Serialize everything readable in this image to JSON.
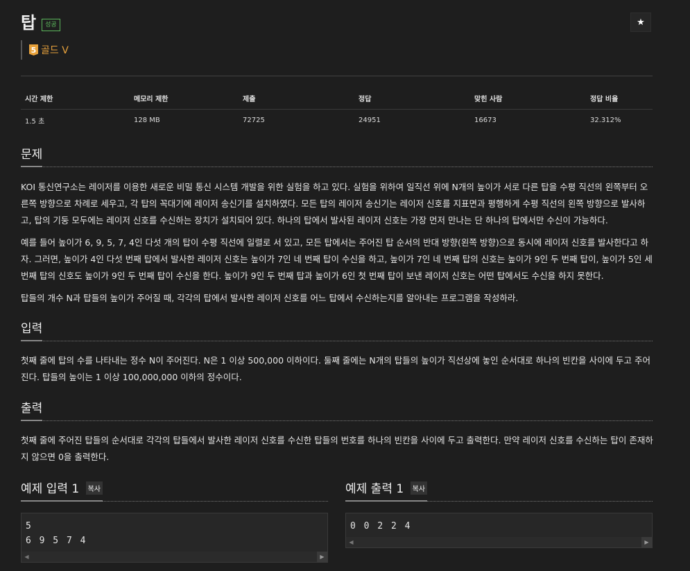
{
  "problem": {
    "title": "탑",
    "status_badge": "성공",
    "tier_number": "5",
    "tier_label": "골드 V",
    "star_icon": "★"
  },
  "stats": {
    "headers": [
      "시간 제한",
      "메모리 제한",
      "제출",
      "정답",
      "맞힌 사람",
      "정답 비율"
    ],
    "values": [
      "1.5 초",
      "128 MB",
      "72725",
      "24951",
      "16673",
      "32.312%"
    ]
  },
  "sections": {
    "description": {
      "heading": "문제",
      "paragraphs": [
        "KOI 통신연구소는 레이저를 이용한 새로운 비밀 통신 시스템 개발을 위한 실험을 하고 있다. 실험을 위하여 일직선 위에 N개의 높이가 서로 다른 탑을 수평 직선의 왼쪽부터 오른쪽 방향으로 차례로 세우고, 각 탑의 꼭대기에 레이저 송신기를 설치하였다. 모든 탑의 레이저 송신기는 레이저 신호를 지표면과 평행하게 수평 직선의 왼쪽 방향으로 발사하고, 탑의 기둥 모두에는 레이저 신호를 수신하는 장치가 설치되어 있다. 하나의 탑에서 발사된 레이저 신호는 가장 먼저 만나는 단 하나의 탑에서만 수신이 가능하다.",
        "예를 들어 높이가 6, 9, 5, 7, 4인 다섯 개의 탑이 수평 직선에 일렬로 서 있고, 모든 탑에서는 주어진 탑 순서의 반대 방향(왼쪽 방향)으로 동시에 레이저 신호를 발사한다고 하자. 그러면, 높이가 4인 다섯 번째 탑에서 발사한 레이저 신호는 높이가 7인 네 번째 탑이 수신을 하고, 높이가 7인 네 번째 탑의 신호는 높이가 9인 두 번째 탑이, 높이가 5인 세 번째 탑의 신호도 높이가 9인 두 번째 탑이 수신을 한다. 높이가 9인 두 번째 탑과 높이가 6인 첫 번째 탑이 보낸 레이저 신호는 어떤 탑에서도 수신을 하지 못한다.",
        "탑들의 개수 N과 탑들의 높이가 주어질 때, 각각의 탑에서 발사한 레이저 신호를 어느 탑에서 수신하는지를 알아내는 프로그램을 작성하라."
      ]
    },
    "input": {
      "heading": "입력",
      "paragraphs": [
        "첫째 줄에 탑의 수를 나타내는 정수 N이 주어진다. N은 1 이상 500,000 이하이다. 둘째 줄에는 N개의 탑들의 높이가 직선상에 놓인 순서대로 하나의 빈칸을 사이에 두고 주어진다. 탑들의 높이는 1 이상 100,000,000 이하의 정수이다."
      ]
    },
    "output": {
      "heading": "출력",
      "paragraphs": [
        "첫째 줄에 주어진 탑들의 순서대로 각각의 탑들에서 발사한 레이저 신호를 수신한 탑들의 번호를 하나의 빈칸을 사이에 두고 출력한다. 만약 레이저 신호를 수신하는 탑이 존재하지 않으면 0을 출력한다."
      ]
    }
  },
  "samples": {
    "input": {
      "heading": "예제 입력 1",
      "copy_label": "복사",
      "content": "5\n6 9 5 7 4"
    },
    "output": {
      "heading": "예제 출력 1",
      "copy_label": "복사",
      "content": "0 0 2 2 4"
    }
  },
  "scrollbar": {
    "left_arrow": "◀",
    "right_arrow": "▶"
  }
}
